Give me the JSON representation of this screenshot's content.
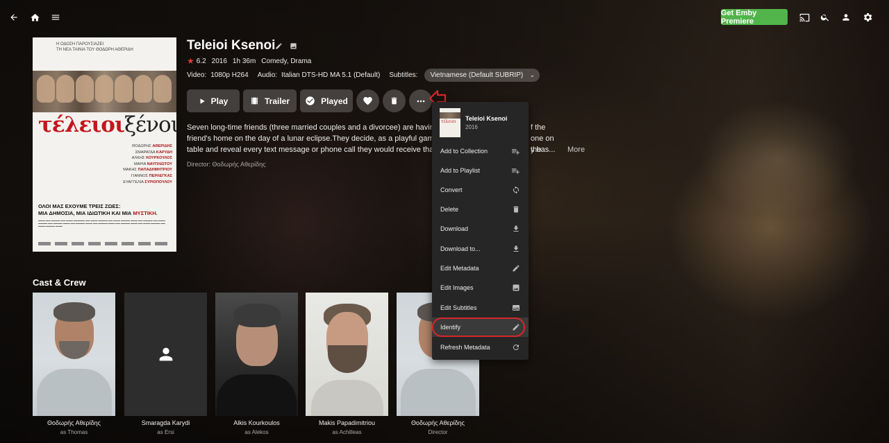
{
  "topbar": {
    "premiere_label": "Get Emby Premiere",
    "icons": [
      "back-arrow-icon",
      "home-icon",
      "hamburger-menu-icon",
      "cast-icon",
      "search-icon",
      "user-icon",
      "settings-gear-icon"
    ]
  },
  "poster": {
    "top_line1": "Η ΟΔΟΣΗ ΠΑΡΟΥΣΙΑΖΕΙ",
    "top_line2": "ΤΗ ΝΕΑ ΤΑΙΝΙΑ ΤΟΥ ΘΟΔΩΡΗ ΑΘΕΡΙΔΗ",
    "title_a": "τέλειοι",
    "title_b": "ξένοι",
    "names": [
      {
        "first": "ΘΟΔΩΡΗΣ",
        "last": "ΑΘΕΡΙΔΗΣ"
      },
      {
        "first": "ΣΜΑΡΑΓΔΑ",
        "last": "ΚΑΡΥΔΗ"
      },
      {
        "first": "ΑΛΚΗΣ",
        "last": "ΚΟΥΡΚΟΥΛΟΣ"
      },
      {
        "first": "ΜΑΡΙΑ",
        "last": "ΝΑΥΠΛΙΩΤΟΥ"
      },
      {
        "first": "ΜΑΚΗΣ",
        "last": "ΠΑΠΑΔΗΜΗΤΡΙΟΥ"
      },
      {
        "first": "ΓΙΑΝΝΟΣ",
        "last": "ΠΕΡΛΕΓΚΑΣ"
      },
      {
        "first": "ΕΥΑΓΓΕΛΙΑ",
        "last": "ΣΥΡΙΟΠΟΥΛΟΥ"
      }
    ],
    "tagline1": "ΟΛΟΙ ΜΑΣ ΕΧΟΥΜΕ ΤΡΕΙΣ ΖΩΕΣ:",
    "tagline2a": "ΜΙΑ ΔΗΜΟΣΙΑ, ΜΙΑ ΙΔΙΩΤΙΚΗ ΚΑΙ ΜΙΑ ",
    "tagline2b": "ΜΥΣΤΙΚΗ."
  },
  "details": {
    "title": "Teleioi Ksenoi",
    "rating": "6.2",
    "year": "2016",
    "runtime": "1h 36m",
    "genres": "Comedy, Drama",
    "video_label": "Video:",
    "video_value": "1080p H264",
    "audio_label": "Audio:",
    "audio_value": "Italian DTS-HD MA 5.1 (Default)",
    "subtitles_label": "Subtitles:",
    "subtitles_value": "Vietnamese (Default SUBRIP)",
    "overview_line1": "Seven long-time friends (three married couples and a divorcee) are having",
    "overview_line1_tail": "f the",
    "overview_line2": "friend's home on the day of a lunar eclipse.They decide, as a playful game",
    "overview_line2_tail": "one on the",
    "overview_line3": "table and reveal every text message or phone call they would receive that",
    "overview_line3_tail": "y has...",
    "more_label": "More",
    "director": "Director: Θοδωρής Αθερίδης"
  },
  "actions": {
    "play": "Play",
    "trailer": "Trailer",
    "played": "Played"
  },
  "cast": {
    "heading": "Cast & Crew",
    "people": [
      {
        "name": "Θοδωρής Αθερίδης",
        "role": "as Thomas"
      },
      {
        "name": "Smaragda Karydi",
        "role": "as Ersi"
      },
      {
        "name": "Alkis Kourkoulos",
        "role": "as Alekos"
      },
      {
        "name": "Makis Papadimitriou",
        "role": "as Achilleas"
      },
      {
        "name": "Θοδωρής Αθερίδης",
        "role": "Director"
      }
    ]
  },
  "context_menu": {
    "title": "Teleioi Ksenoi",
    "year": "2016",
    "items": [
      {
        "label": "Add to Collection",
        "icon": "playlist-add-icon"
      },
      {
        "label": "Add to Playlist",
        "icon": "playlist-add-icon"
      },
      {
        "label": "Convert",
        "icon": "sync-icon"
      },
      {
        "label": "Delete",
        "icon": "trash-icon"
      },
      {
        "label": "Download",
        "icon": "download-icon"
      },
      {
        "label": "Download to...",
        "icon": "download-icon"
      },
      {
        "label": "Edit Metadata",
        "icon": "pencil-icon"
      },
      {
        "label": "Edit Images",
        "icon": "image-icon"
      },
      {
        "label": "Edit Subtitles",
        "icon": "subtitles-icon"
      },
      {
        "label": "Identify",
        "icon": "pencil-icon"
      },
      {
        "label": "Refresh Metadata",
        "icon": "refresh-icon"
      }
    ],
    "highlight_color": "#d9262a"
  },
  "colors": {
    "accent_green": "#52b54b",
    "rating_star": "#e63a2e",
    "annotation_red": "#d9262a"
  }
}
